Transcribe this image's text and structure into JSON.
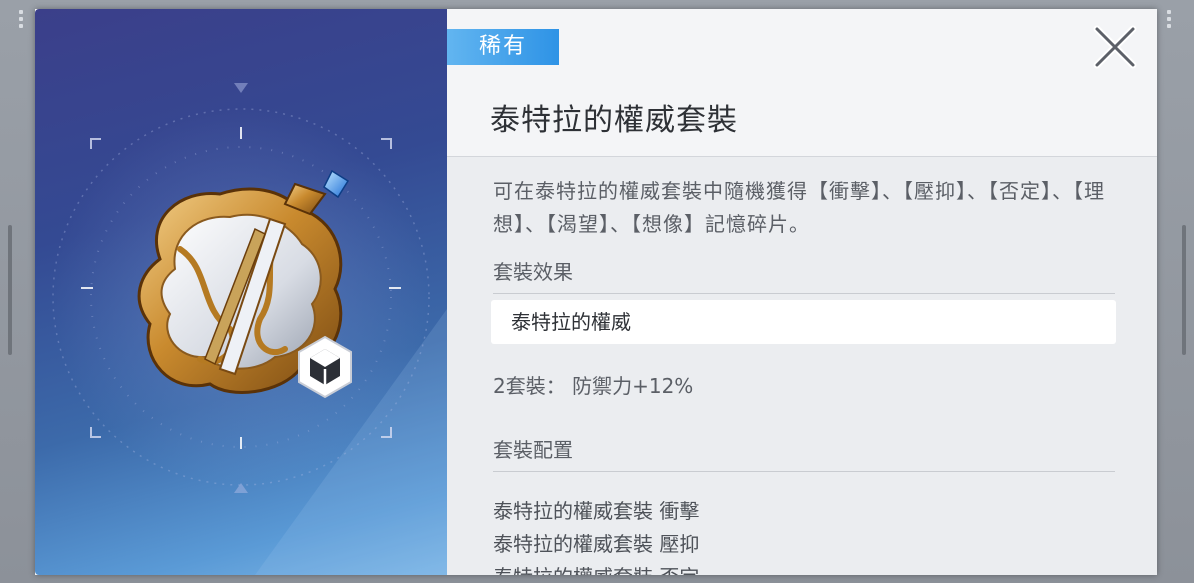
{
  "item": {
    "rarity": "稀有",
    "title": "泰特拉的權威套裝",
    "description": "可在泰特拉的權威套裝中隨機獲得【衝擊】、【壓抑】、【否定】、【理想】、【渴望】、【想像】記憶碎片。",
    "rarity_color": "#3d9ce8"
  },
  "set_effect": {
    "heading": "套裝效果",
    "set_name": "泰特拉的權威",
    "bonus": "2套裝： 防禦力+12%"
  },
  "set_config": {
    "heading": "套裝配置",
    "items": [
      "泰特拉的權威套裝 衝擊",
      "泰特拉的權威套裝 壓抑",
      "泰特拉的權威套裝 否定"
    ]
  },
  "icons": {
    "close": "close-icon",
    "box": "cube-badge-icon",
    "emblem": "armor-set-emblem"
  }
}
